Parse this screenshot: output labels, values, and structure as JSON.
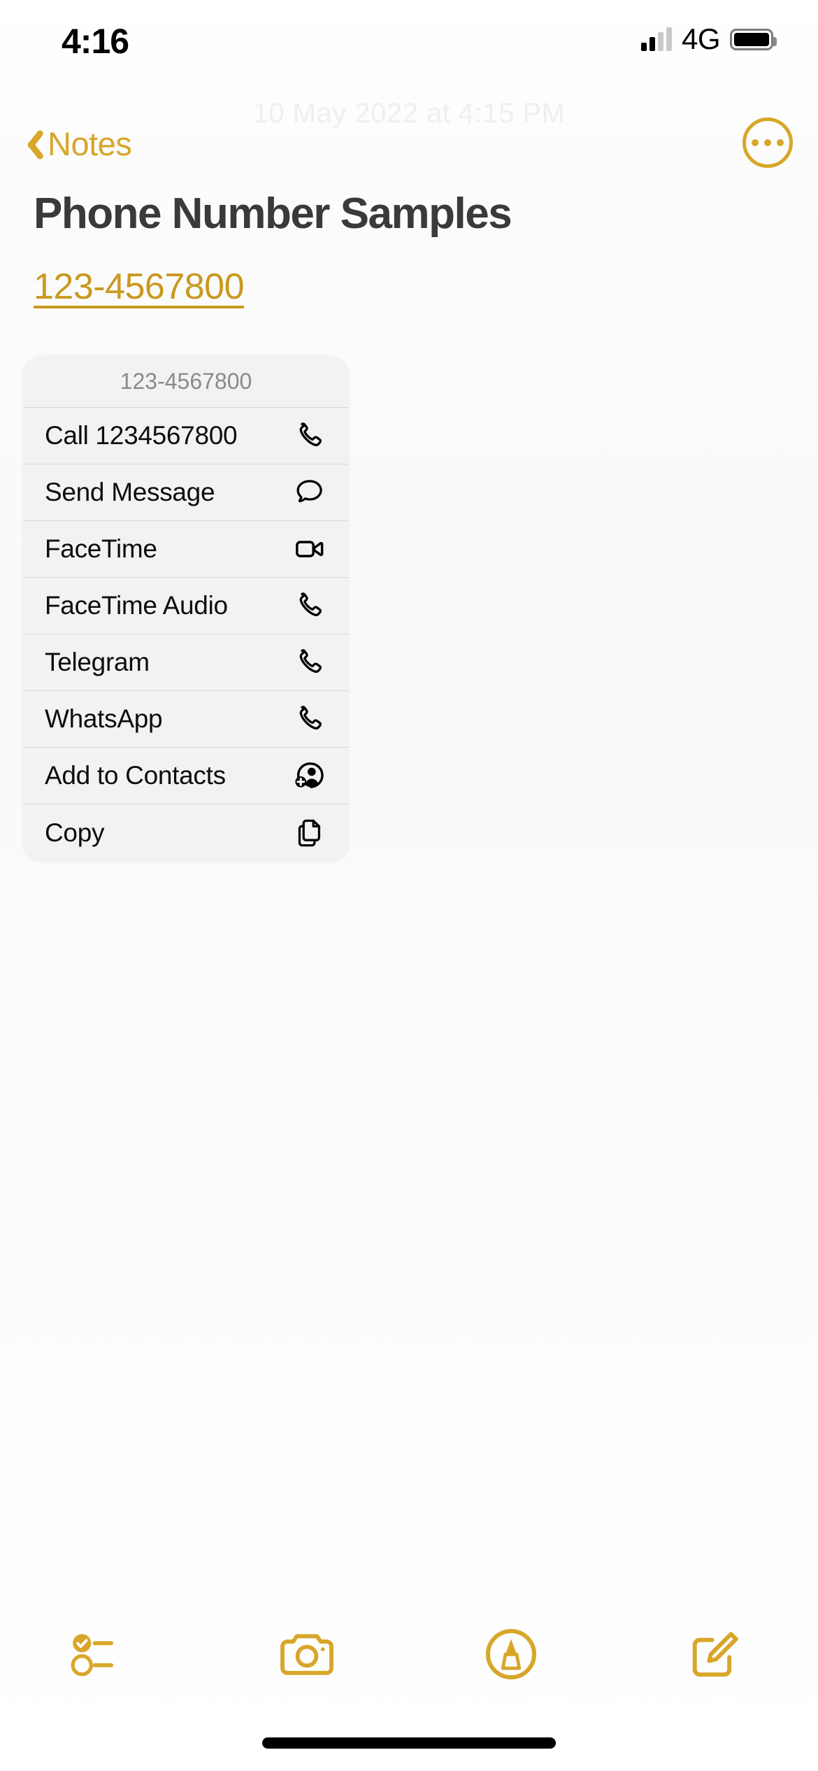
{
  "status_bar": {
    "time": "4:16",
    "network": "4G",
    "signal_icon": "cellular-bars-icon",
    "battery_icon": "battery-full-icon"
  },
  "nav_bar": {
    "back_label": "Notes",
    "back_icon": "chevron-left-icon",
    "more_icon": "ellipsis-circle-icon"
  },
  "note": {
    "date_watermark": "10 May 2022 at 4:15 PM",
    "title": "Phone Number Samples",
    "phone_link": "123-4567800"
  },
  "action_sheet": {
    "header": "123-4567800",
    "items": [
      {
        "label": "Call 1234567800",
        "icon": "phone-icon"
      },
      {
        "label": "Send Message",
        "icon": "message-bubble-icon"
      },
      {
        "label": "FaceTime",
        "icon": "video-camera-icon"
      },
      {
        "label": "FaceTime Audio",
        "icon": "phone-icon"
      },
      {
        "label": "Telegram",
        "icon": "phone-icon"
      },
      {
        "label": "WhatsApp",
        "icon": "phone-icon"
      },
      {
        "label": "Add to Contacts",
        "icon": "person-badge-plus-icon"
      },
      {
        "label": "Copy",
        "icon": "copy-documents-icon"
      }
    ]
  },
  "toolbar": {
    "items": [
      {
        "name": "checklist-button",
        "icon": "checklist-icon"
      },
      {
        "name": "camera-button",
        "icon": "camera-icon"
      },
      {
        "name": "markup-button",
        "icon": "markup-pen-icon"
      },
      {
        "name": "compose-button",
        "icon": "compose-icon"
      }
    ]
  },
  "colors": {
    "accent": "#d8a62a",
    "link": "#c9991f",
    "title": "#3a3a3a",
    "sheet_bg": "#f2f2f2",
    "separator": "#d7d7d7",
    "header_text": "#8a8a8a"
  }
}
